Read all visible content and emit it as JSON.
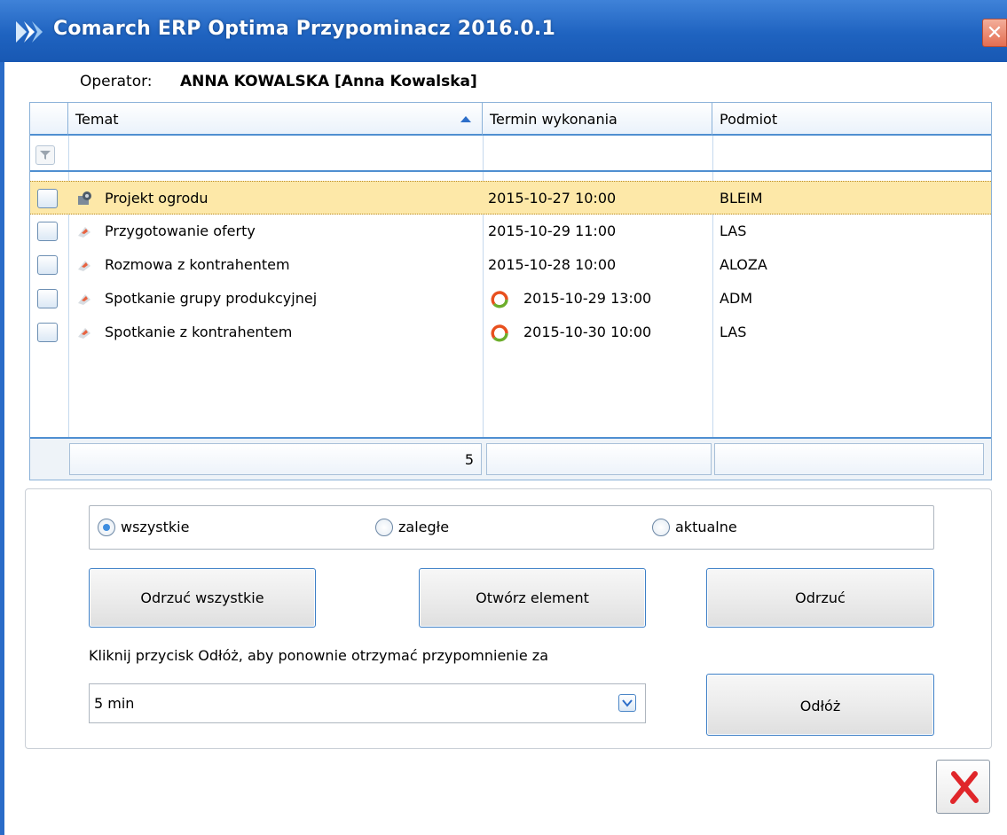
{
  "window": {
    "title": "Comarch ERP Optima Przypominacz 2016.0.1",
    "close_glyph": "✕"
  },
  "operator": {
    "label": "Operator:",
    "value": "ANNA KOWALSKA [Anna Kowalska]"
  },
  "grid": {
    "columns": [
      "Temat",
      "Termin wykonania",
      "Podmiot"
    ],
    "sorted_column": "Temat",
    "sort_direction": "ascending",
    "rows": [
      {
        "topic": "Projekt ogrodu",
        "date": "2015-10-27 10:00",
        "subject": "BLEIM",
        "icon": "task-gear-icon",
        "alert": false,
        "selected": true
      },
      {
        "topic": "Przygotowanie oferty",
        "date": "2015-10-29 11:00",
        "subject": "LAS",
        "icon": "task-flag-icon",
        "alert": false,
        "selected": false
      },
      {
        "topic": "Rozmowa z kontrahentem",
        "date": "2015-10-28 10:00",
        "subject": "ALOZA",
        "icon": "task-flag-icon",
        "alert": false,
        "selected": false
      },
      {
        "topic": "Spotkanie grupy produkcyjnej",
        "date": "2015-10-29 13:00",
        "subject": "ADM",
        "icon": "task-flag-icon",
        "alert": true,
        "selected": false
      },
      {
        "topic": "Spotkanie z kontrahentem",
        "date": "2015-10-30 10:00",
        "subject": "LAS",
        "icon": "task-flag-icon",
        "alert": true,
        "selected": false
      }
    ],
    "count": "5"
  },
  "filters": {
    "options": [
      {
        "label": "wszystkie",
        "selected": true
      },
      {
        "label": "zaległe",
        "selected": false
      },
      {
        "label": "aktualne",
        "selected": false
      }
    ]
  },
  "buttons": {
    "dismiss_all": "Odrzuć wszystkie",
    "open_item": "Otwórz element",
    "dismiss": "Odrzuć",
    "snooze": "Odłóż"
  },
  "snooze": {
    "hint": "Kliknij przycisk Odłóż, aby ponownie otrzymać przypomnienie za",
    "value": "5 min"
  },
  "colors": {
    "titlebar": "#1f63c0",
    "selected_row": "#fde8a8",
    "accent": "#4f8fd1",
    "close_x": "#e0262a"
  }
}
